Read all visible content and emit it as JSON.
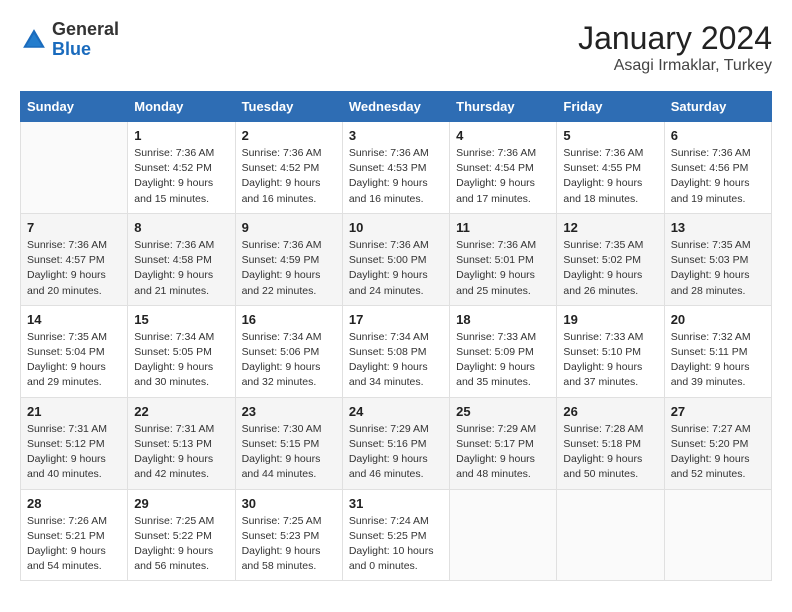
{
  "header": {
    "logo_general": "General",
    "logo_blue": "Blue",
    "title": "January 2024",
    "subtitle": "Asagi Irmaklar, Turkey"
  },
  "weekdays": [
    "Sunday",
    "Monday",
    "Tuesday",
    "Wednesday",
    "Thursday",
    "Friday",
    "Saturday"
  ],
  "weeks": [
    [
      {
        "day": "",
        "sunrise": "",
        "sunset": "",
        "daylight": ""
      },
      {
        "day": "1",
        "sunrise": "Sunrise: 7:36 AM",
        "sunset": "Sunset: 4:52 PM",
        "daylight": "Daylight: 9 hours and 15 minutes."
      },
      {
        "day": "2",
        "sunrise": "Sunrise: 7:36 AM",
        "sunset": "Sunset: 4:52 PM",
        "daylight": "Daylight: 9 hours and 16 minutes."
      },
      {
        "day": "3",
        "sunrise": "Sunrise: 7:36 AM",
        "sunset": "Sunset: 4:53 PM",
        "daylight": "Daylight: 9 hours and 16 minutes."
      },
      {
        "day": "4",
        "sunrise": "Sunrise: 7:36 AM",
        "sunset": "Sunset: 4:54 PM",
        "daylight": "Daylight: 9 hours and 17 minutes."
      },
      {
        "day": "5",
        "sunrise": "Sunrise: 7:36 AM",
        "sunset": "Sunset: 4:55 PM",
        "daylight": "Daylight: 9 hours and 18 minutes."
      },
      {
        "day": "6",
        "sunrise": "Sunrise: 7:36 AM",
        "sunset": "Sunset: 4:56 PM",
        "daylight": "Daylight: 9 hours and 19 minutes."
      }
    ],
    [
      {
        "day": "7",
        "sunrise": "Sunrise: 7:36 AM",
        "sunset": "Sunset: 4:57 PM",
        "daylight": "Daylight: 9 hours and 20 minutes."
      },
      {
        "day": "8",
        "sunrise": "Sunrise: 7:36 AM",
        "sunset": "Sunset: 4:58 PM",
        "daylight": "Daylight: 9 hours and 21 minutes."
      },
      {
        "day": "9",
        "sunrise": "Sunrise: 7:36 AM",
        "sunset": "Sunset: 4:59 PM",
        "daylight": "Daylight: 9 hours and 22 minutes."
      },
      {
        "day": "10",
        "sunrise": "Sunrise: 7:36 AM",
        "sunset": "Sunset: 5:00 PM",
        "daylight": "Daylight: 9 hours and 24 minutes."
      },
      {
        "day": "11",
        "sunrise": "Sunrise: 7:36 AM",
        "sunset": "Sunset: 5:01 PM",
        "daylight": "Daylight: 9 hours and 25 minutes."
      },
      {
        "day": "12",
        "sunrise": "Sunrise: 7:35 AM",
        "sunset": "Sunset: 5:02 PM",
        "daylight": "Daylight: 9 hours and 26 minutes."
      },
      {
        "day": "13",
        "sunrise": "Sunrise: 7:35 AM",
        "sunset": "Sunset: 5:03 PM",
        "daylight": "Daylight: 9 hours and 28 minutes."
      }
    ],
    [
      {
        "day": "14",
        "sunrise": "Sunrise: 7:35 AM",
        "sunset": "Sunset: 5:04 PM",
        "daylight": "Daylight: 9 hours and 29 minutes."
      },
      {
        "day": "15",
        "sunrise": "Sunrise: 7:34 AM",
        "sunset": "Sunset: 5:05 PM",
        "daylight": "Daylight: 9 hours and 30 minutes."
      },
      {
        "day": "16",
        "sunrise": "Sunrise: 7:34 AM",
        "sunset": "Sunset: 5:06 PM",
        "daylight": "Daylight: 9 hours and 32 minutes."
      },
      {
        "day": "17",
        "sunrise": "Sunrise: 7:34 AM",
        "sunset": "Sunset: 5:08 PM",
        "daylight": "Daylight: 9 hours and 34 minutes."
      },
      {
        "day": "18",
        "sunrise": "Sunrise: 7:33 AM",
        "sunset": "Sunset: 5:09 PM",
        "daylight": "Daylight: 9 hours and 35 minutes."
      },
      {
        "day": "19",
        "sunrise": "Sunrise: 7:33 AM",
        "sunset": "Sunset: 5:10 PM",
        "daylight": "Daylight: 9 hours and 37 minutes."
      },
      {
        "day": "20",
        "sunrise": "Sunrise: 7:32 AM",
        "sunset": "Sunset: 5:11 PM",
        "daylight": "Daylight: 9 hours and 39 minutes."
      }
    ],
    [
      {
        "day": "21",
        "sunrise": "Sunrise: 7:31 AM",
        "sunset": "Sunset: 5:12 PM",
        "daylight": "Daylight: 9 hours and 40 minutes."
      },
      {
        "day": "22",
        "sunrise": "Sunrise: 7:31 AM",
        "sunset": "Sunset: 5:13 PM",
        "daylight": "Daylight: 9 hours and 42 minutes."
      },
      {
        "day": "23",
        "sunrise": "Sunrise: 7:30 AM",
        "sunset": "Sunset: 5:15 PM",
        "daylight": "Daylight: 9 hours and 44 minutes."
      },
      {
        "day": "24",
        "sunrise": "Sunrise: 7:29 AM",
        "sunset": "Sunset: 5:16 PM",
        "daylight": "Daylight: 9 hours and 46 minutes."
      },
      {
        "day": "25",
        "sunrise": "Sunrise: 7:29 AM",
        "sunset": "Sunset: 5:17 PM",
        "daylight": "Daylight: 9 hours and 48 minutes."
      },
      {
        "day": "26",
        "sunrise": "Sunrise: 7:28 AM",
        "sunset": "Sunset: 5:18 PM",
        "daylight": "Daylight: 9 hours and 50 minutes."
      },
      {
        "day": "27",
        "sunrise": "Sunrise: 7:27 AM",
        "sunset": "Sunset: 5:20 PM",
        "daylight": "Daylight: 9 hours and 52 minutes."
      }
    ],
    [
      {
        "day": "28",
        "sunrise": "Sunrise: 7:26 AM",
        "sunset": "Sunset: 5:21 PM",
        "daylight": "Daylight: 9 hours and 54 minutes."
      },
      {
        "day": "29",
        "sunrise": "Sunrise: 7:25 AM",
        "sunset": "Sunset: 5:22 PM",
        "daylight": "Daylight: 9 hours and 56 minutes."
      },
      {
        "day": "30",
        "sunrise": "Sunrise: 7:25 AM",
        "sunset": "Sunset: 5:23 PM",
        "daylight": "Daylight: 9 hours and 58 minutes."
      },
      {
        "day": "31",
        "sunrise": "Sunrise: 7:24 AM",
        "sunset": "Sunset: 5:25 PM",
        "daylight": "Daylight: 10 hours and 0 minutes."
      },
      {
        "day": "",
        "sunrise": "",
        "sunset": "",
        "daylight": ""
      },
      {
        "day": "",
        "sunrise": "",
        "sunset": "",
        "daylight": ""
      },
      {
        "day": "",
        "sunrise": "",
        "sunset": "",
        "daylight": ""
      }
    ]
  ]
}
